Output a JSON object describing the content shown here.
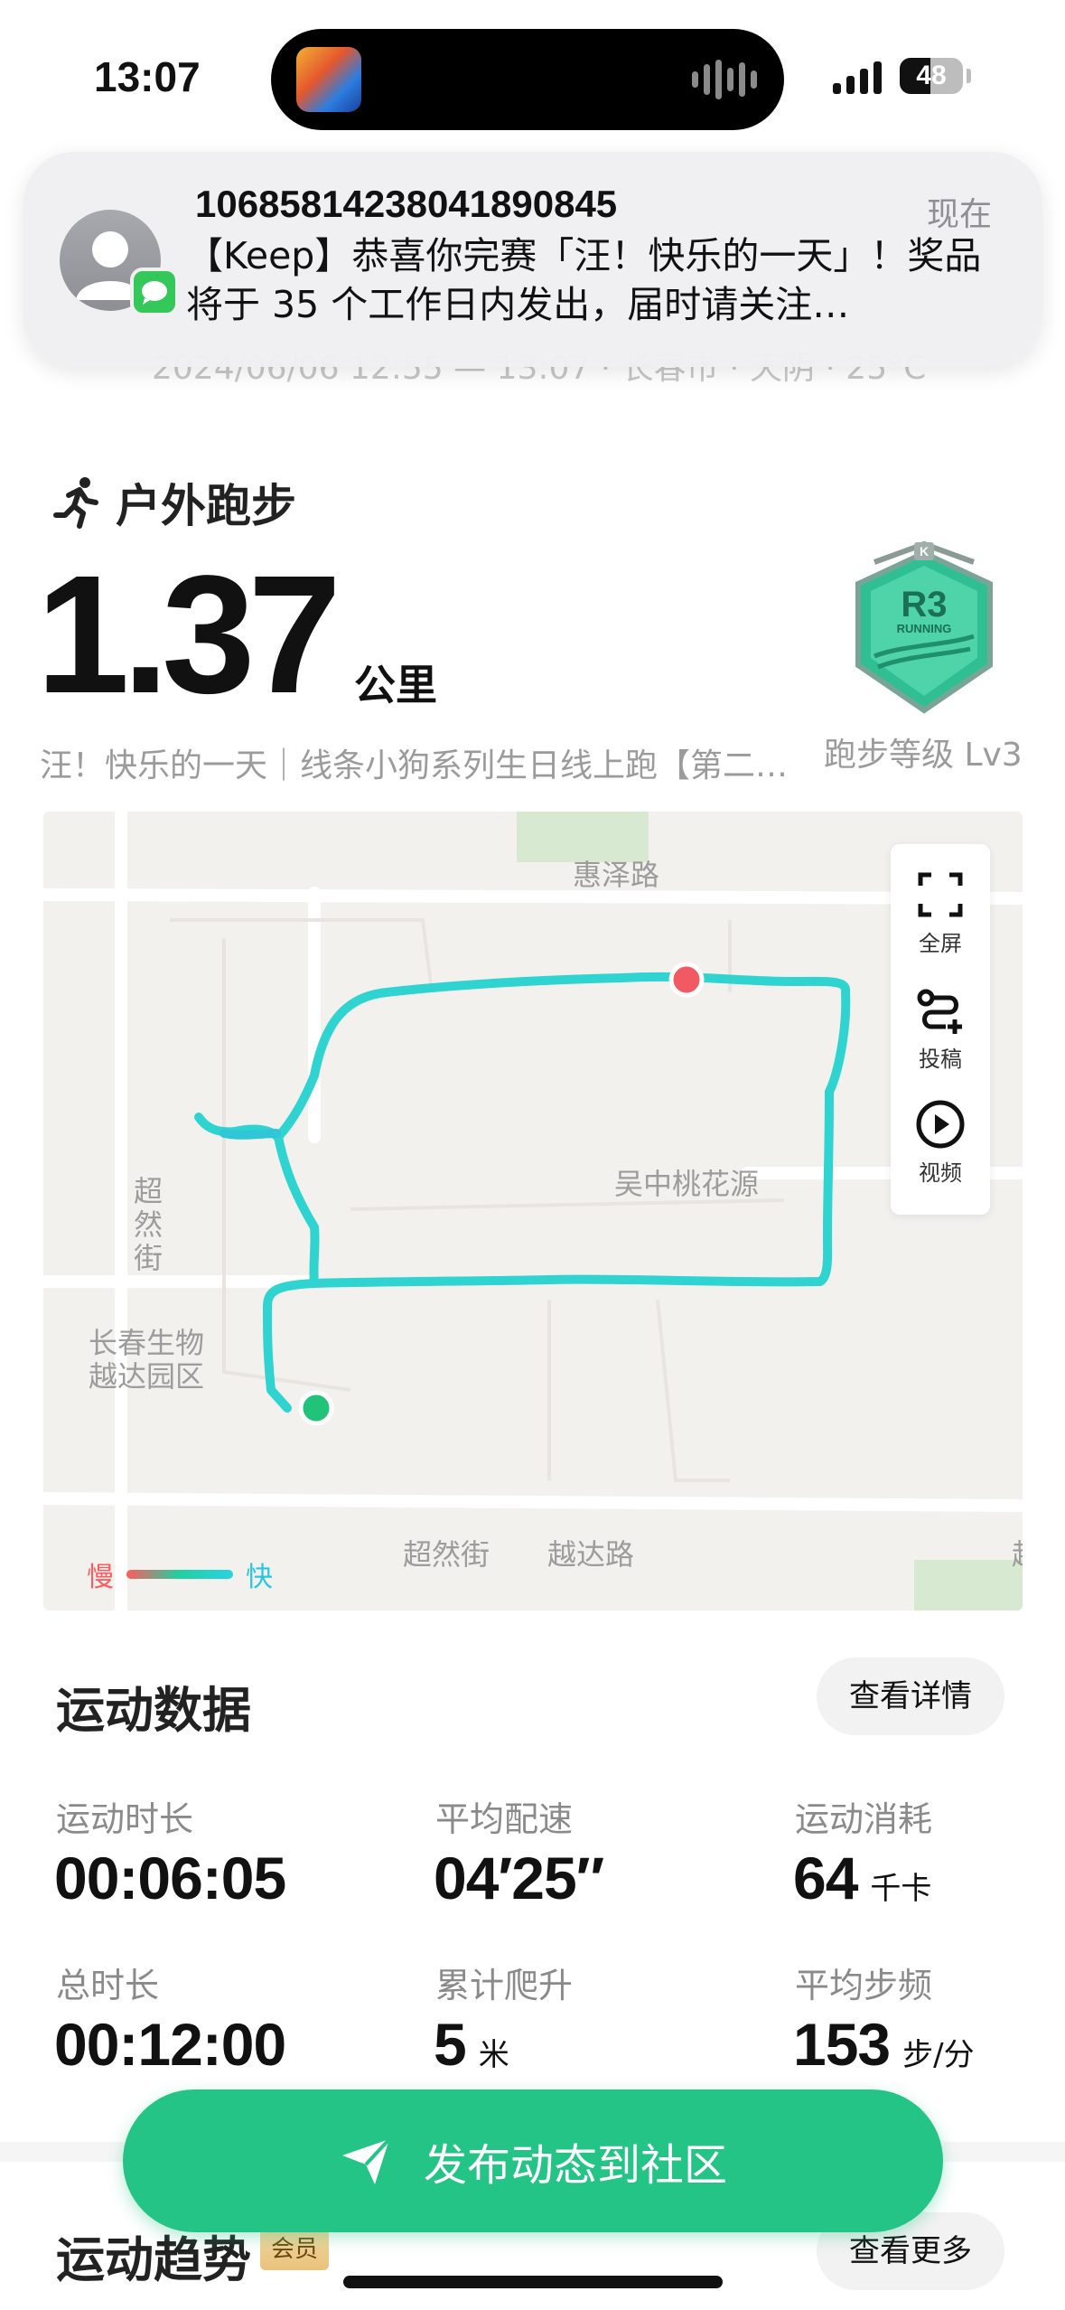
{
  "status_bar": {
    "time": "13:07",
    "battery": "48",
    "battery_level": 0.48
  },
  "notification": {
    "sender": "10685814238041890845",
    "time": "现在",
    "body": "【Keep】恭喜你完赛「汪！快乐的一天」！奖品将于 35 个工作日内发出，届时请关注…",
    "app_icon": "messages-icon"
  },
  "ghost_info": "2024/06/06 12:55 — 13:07 · 长春市 · 天阴 · 25°C",
  "workout": {
    "type": "户外跑步",
    "distance": "1.37",
    "unit": "公里",
    "event": "汪！快乐的一天｜线条小狗系列生日线上跑【第二…",
    "badge_title": "R3",
    "badge_sub": "RUNNING",
    "level": "跑步等级 Lv3"
  },
  "map": {
    "labels": {
      "north_road": "惠泽路",
      "area": "吴中桃花源",
      "west_street": "超\n然\n街",
      "park": "长春生物\n越达园区",
      "south_street": "超然街",
      "south_road": "越达路",
      "edge": "越"
    },
    "tools": [
      {
        "label": "全屏",
        "icon": "fullscreen-icon"
      },
      {
        "label": "投稿",
        "icon": "route-submit-icon"
      },
      {
        "label": "视频",
        "icon": "play-video-icon"
      }
    ],
    "legend": {
      "slow": "慢",
      "fast": "快"
    },
    "colors": {
      "route": "#2fd3cf",
      "start": "#21c27a",
      "end": "#f15a62"
    }
  },
  "stats": {
    "title": "运动数据",
    "detail_button": "查看详情",
    "items": [
      {
        "label": "运动时长",
        "value": "00:06:05",
        "unit": ""
      },
      {
        "label": "平均配速",
        "value": "04′25″",
        "unit": ""
      },
      {
        "label": "运动消耗",
        "value": "64",
        "unit": "千卡"
      },
      {
        "label": "总时长",
        "value": "00:12:00",
        "unit": ""
      },
      {
        "label": "累计爬升",
        "value": "5",
        "unit": "米"
      },
      {
        "label": "平均步频",
        "value": "153",
        "unit": "步/分"
      }
    ]
  },
  "post_button": "发布动态到社区",
  "trend": {
    "title": "运动趋势",
    "badge": "会员",
    "more_button": "查看更多"
  }
}
